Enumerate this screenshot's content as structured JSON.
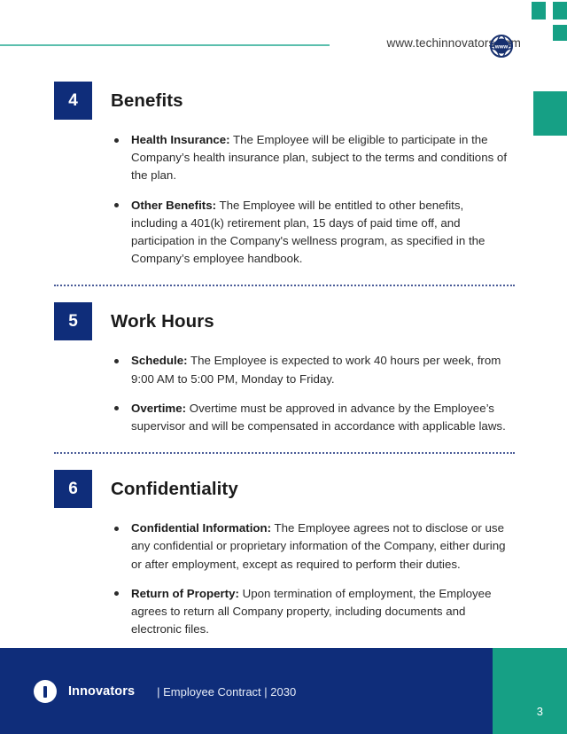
{
  "header": {
    "website": "www.techinnovators.com",
    "globe_icon": "globe-www-icon"
  },
  "colors": {
    "navy": "#0f2d7a",
    "green": "#16a085",
    "rule_teal": "#5bbfad",
    "body_text": "#2b2b2b"
  },
  "sections": [
    {
      "number": "4",
      "title": "Benefits",
      "bullets": [
        {
          "label": "Health Insurance:",
          "text": " The Employee will be eligible to participate in the Company’s health insurance plan, subject to the terms and conditions of the plan."
        },
        {
          "label": "Other Benefits:",
          "text": " The Employee will be entitled to other benefits, including a 401(k) retirement plan, 15 days of paid time off, and participation in the Company's wellness program, as specified in the Company’s employee handbook."
        }
      ]
    },
    {
      "number": "5",
      "title": "Work Hours",
      "bullets": [
        {
          "label": "Schedule:",
          "text": " The Employee is expected to work 40 hours per week, from 9:00 AM to 5:00 PM, Monday to Friday."
        },
        {
          "label": "Overtime:",
          "text": " Overtime must be approved in advance by the Employee’s supervisor and will be compensated in accordance with applicable laws."
        }
      ]
    },
    {
      "number": "6",
      "title": "Confidentiality",
      "bullets": [
        {
          "label": "Confidential Information:",
          "text": " The Employee agrees not to disclose or use any confidential or proprietary information of the Company, either during or after employment, except as required to perform their duties."
        },
        {
          "label": "Return of Property:",
          "text": " Upon termination of employment, the Employee agrees to return all Company property, including documents and electronic files."
        }
      ]
    }
  ],
  "footer": {
    "logo_icon": "innovators-circle-logo",
    "brand": "Innovators",
    "meta": "|  Employee Contract | 2030",
    "page_number": "3"
  }
}
